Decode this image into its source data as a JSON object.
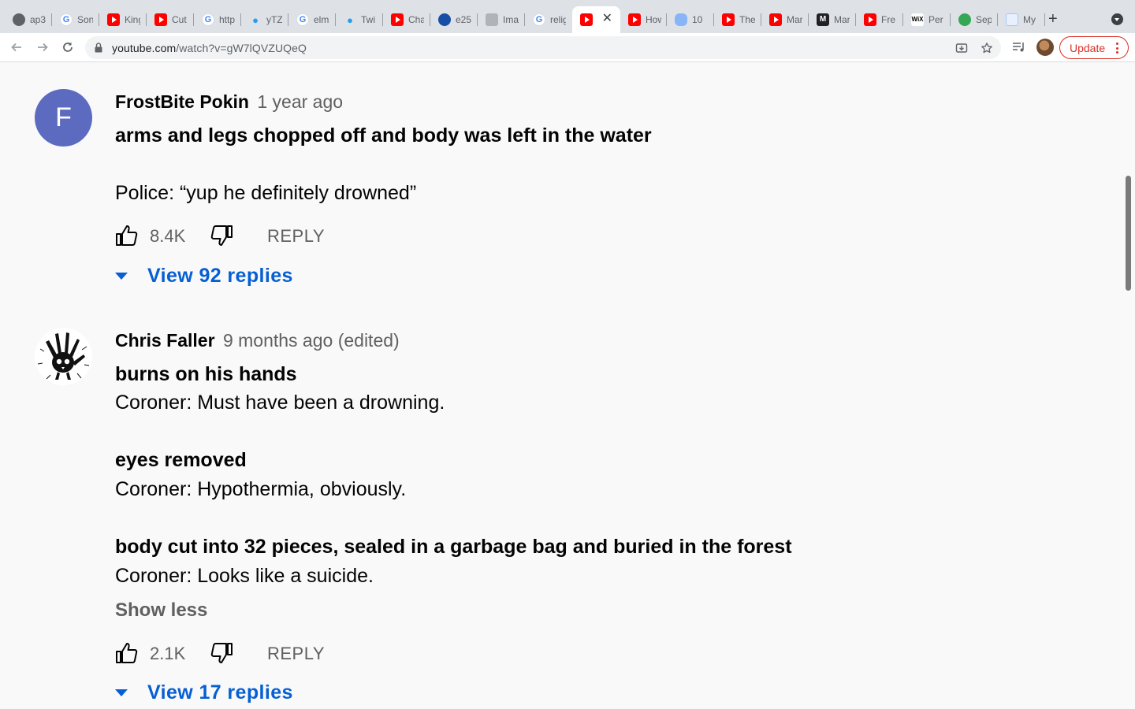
{
  "browser": {
    "tabs": [
      {
        "label": "ap3",
        "icon": "chrome-icon"
      },
      {
        "label": "Son",
        "icon": "google-icon"
      },
      {
        "label": "King",
        "icon": "youtube-icon"
      },
      {
        "label": "Cut",
        "icon": "youtube-icon"
      },
      {
        "label": "http",
        "icon": "google-icon"
      },
      {
        "label": "yTZ",
        "icon": "twitter-icon"
      },
      {
        "label": "elm",
        "icon": "google-icon"
      },
      {
        "label": "Twi",
        "icon": "twitter-icon"
      },
      {
        "label": "Cha",
        "icon": "youtube-icon"
      },
      {
        "label": "e25",
        "icon": "blue-logo-icon"
      },
      {
        "label": "Ima",
        "icon": "image-icon"
      },
      {
        "label": "relig",
        "icon": "google-icon"
      },
      {
        "label": "",
        "icon": "youtube-icon",
        "active": true
      },
      {
        "label": "How",
        "icon": "youtube-icon"
      },
      {
        "label": "10",
        "icon": "cloud-icon"
      },
      {
        "label": "The",
        "icon": "youtube-icon"
      },
      {
        "label": "Mar",
        "icon": "youtube-icon"
      },
      {
        "label": "Mar",
        "icon": "medium-icon"
      },
      {
        "label": "Fre",
        "icon": "youtube-icon"
      },
      {
        "label": "Per",
        "icon": "wix-icon"
      },
      {
        "label": "Sep",
        "icon": "multicolor-icon"
      },
      {
        "label": "My",
        "icon": "doc-icon"
      }
    ],
    "url_host": "youtube.com",
    "url_path": "/watch?v=gW7lQVZUQeQ",
    "update_label": "Update"
  },
  "comments": [
    {
      "avatar_letter": "F",
      "author": "FrostBite Pokin",
      "meta": "1 year ago",
      "lines": [
        "arms and legs chopped off and body was left in the water",
        "Police: “yup he definitely drowned”"
      ],
      "likes": "8.4K",
      "reply_label": "REPLY",
      "view_replies": "View 92 replies"
    },
    {
      "author": "Chris Faller",
      "meta": "9 months ago (edited)",
      "lines": [
        "burns on his hands",
        "Coroner: Must have been a drowning.",
        "eyes removed",
        "Coroner: Hypothermia, obviously.",
        "body cut into 32 pieces, sealed in a garbage bag and buried in the forest",
        "Coroner: Looks like a suicide."
      ],
      "show_less": "Show less",
      "likes": "2.1K",
      "reply_label": "REPLY",
      "view_replies": "View 17 replies"
    }
  ],
  "colors": {
    "link_blue": "#065fd4",
    "avatar_purple": "#5c6bc0",
    "update_red": "#d93025"
  }
}
